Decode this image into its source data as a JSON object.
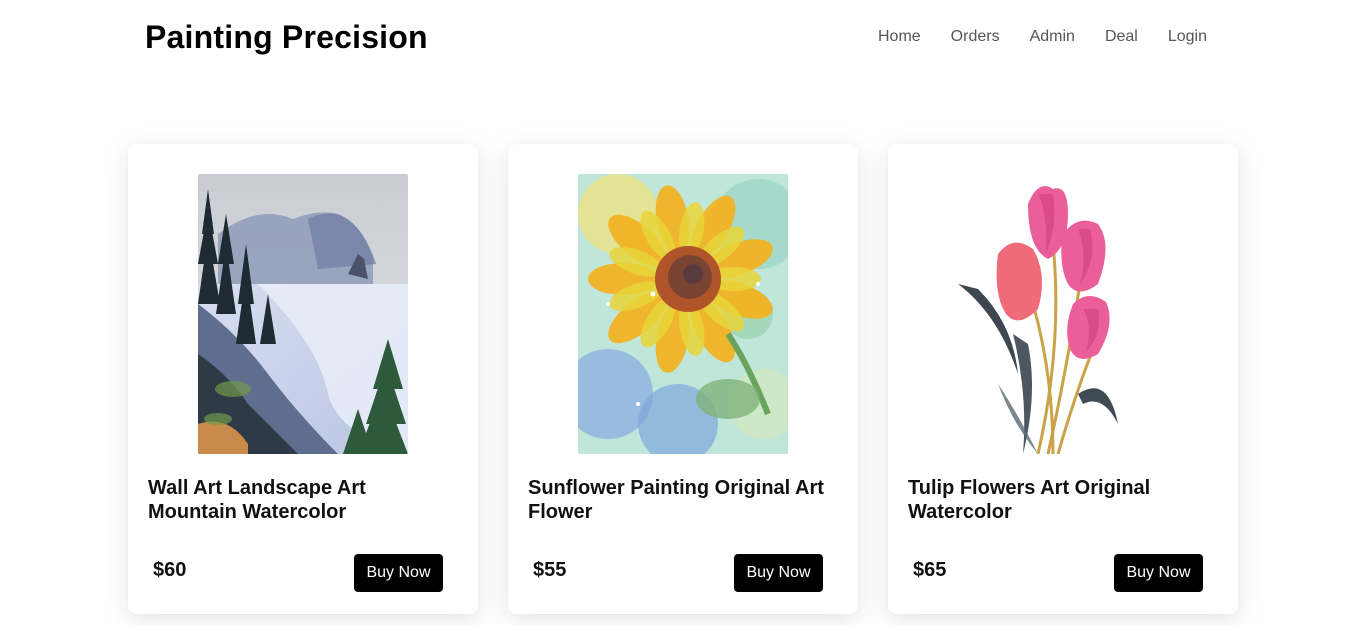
{
  "header": {
    "brand": "Painting Precision",
    "nav": [
      "Home",
      "Orders",
      "Admin",
      "Deal",
      "Login"
    ]
  },
  "products": [
    {
      "title": "Wall Art Landscape Art Mountain Watercolor",
      "price": "$60",
      "button": "Buy Now",
      "image": "mountain-landscape-watercolor"
    },
    {
      "title": "Sunflower Painting Original Art Flower",
      "price": "$55",
      "button": "Buy Now",
      "image": "sunflower-watercolor"
    },
    {
      "title": "Tulip Flowers Art Original Watercolor",
      "price": "$65",
      "button": "Buy Now",
      "image": "pink-tulips-watercolor"
    }
  ]
}
